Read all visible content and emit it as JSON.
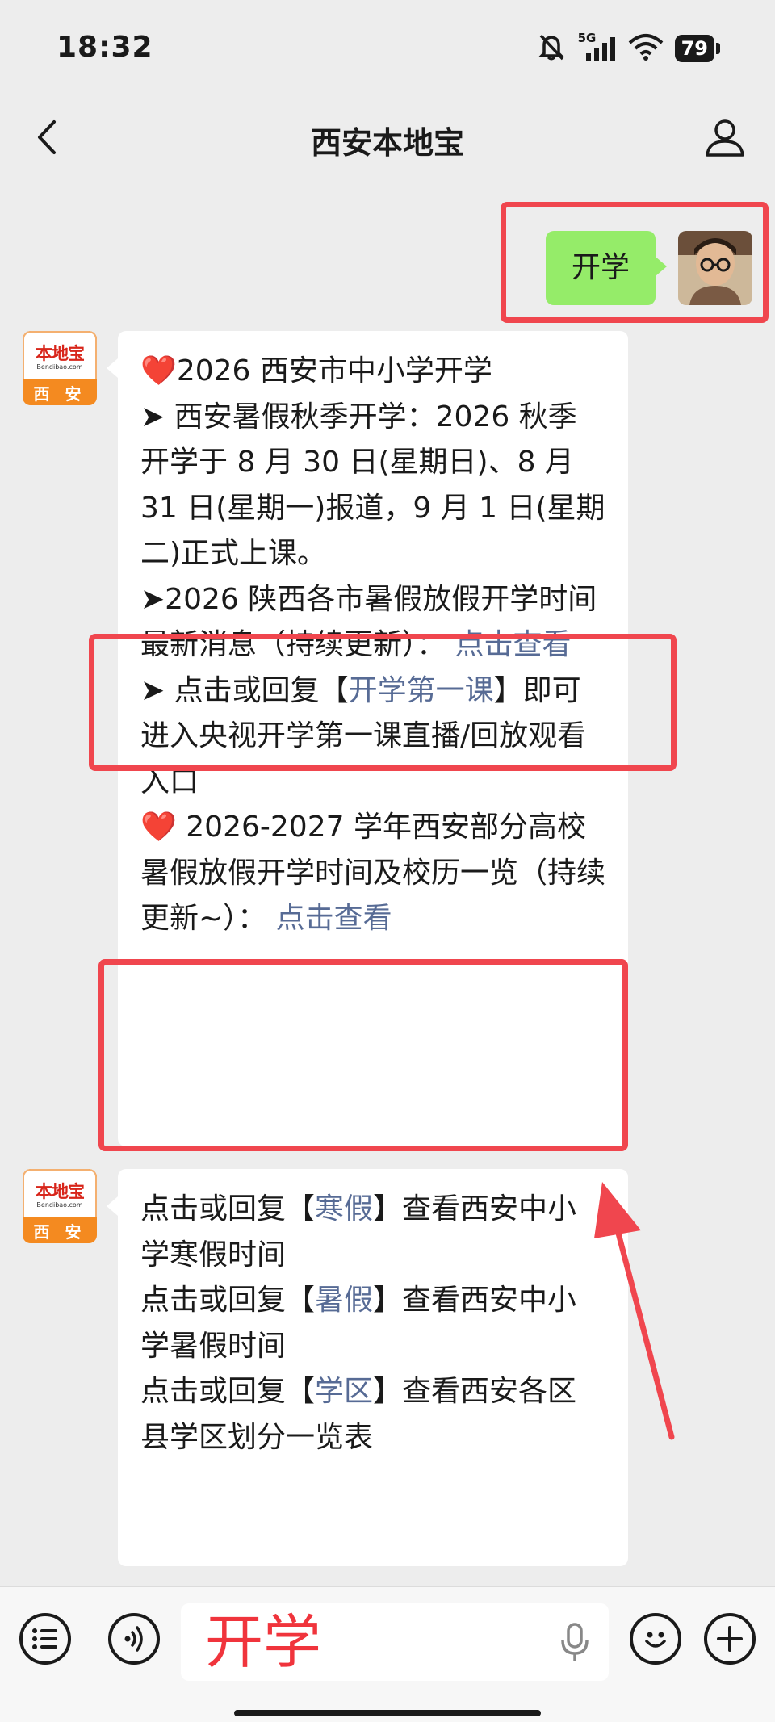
{
  "status_bar": {
    "time": "18:32",
    "network": "5G",
    "battery": "79",
    "icons": [
      "mute-bell-icon",
      "cellular-signal-icon",
      "wifi-icon",
      "battery-icon"
    ]
  },
  "nav": {
    "title": "西安本地宝",
    "back_icon": "chevron-left-icon",
    "profile_icon": "person-icon"
  },
  "chat": {
    "sent_message": "开学",
    "bot_avatar": {
      "logo_text": "本地宝",
      "logo_sub": "Bendibao.com",
      "city": "西 安"
    },
    "message1": {
      "p1": {
        "prefix": "❤️",
        "text": "2026 西安市中小学开学"
      },
      "p2": {
        "text": "➤ 西安暑假秋季开学：2026 秋季开学于 8 月 30 日(星期日)、8 月 31 日(星期一)报道，9 月 1 日(星期二)正式上课。"
      },
      "p3": {
        "text": "➤2026 陕西各市暑假放假开学时间最新消息（持续更新）：",
        "link": "点击查看"
      },
      "p4": {
        "before": "➤ 点击或回复【",
        "link": "开学第一课",
        "after": "】即可进入央视开学第一课直播/回放观看入口"
      },
      "p5": {
        "prefix": "❤️",
        "text": " 2026-2027 学年西安部分高校暑假放假开学时间及校历一览（持续更新~）：",
        "link": "点击查看"
      }
    },
    "message2": {
      "p1": {
        "before": "点击或回复【",
        "link": "寒假",
        "after": "】查看西安中小学寒假时间"
      },
      "p2": {
        "before": "点击或回复【",
        "link": "暑假",
        "after": "】查看西安中小学暑假时间"
      },
      "p3": {
        "before": "点击或回复【",
        "link": "学区",
        "after": "】查看西安各区县学区划分一览表"
      }
    }
  },
  "input_bar": {
    "input_value": "开学",
    "icons": [
      "menu-list-icon",
      "voice-icon",
      "microphone-icon",
      "emoji-icon",
      "plus-icon"
    ]
  },
  "colors": {
    "highlight_box": "#f0464e",
    "link": "#576b95",
    "sent_bubble": "#95ec69"
  }
}
